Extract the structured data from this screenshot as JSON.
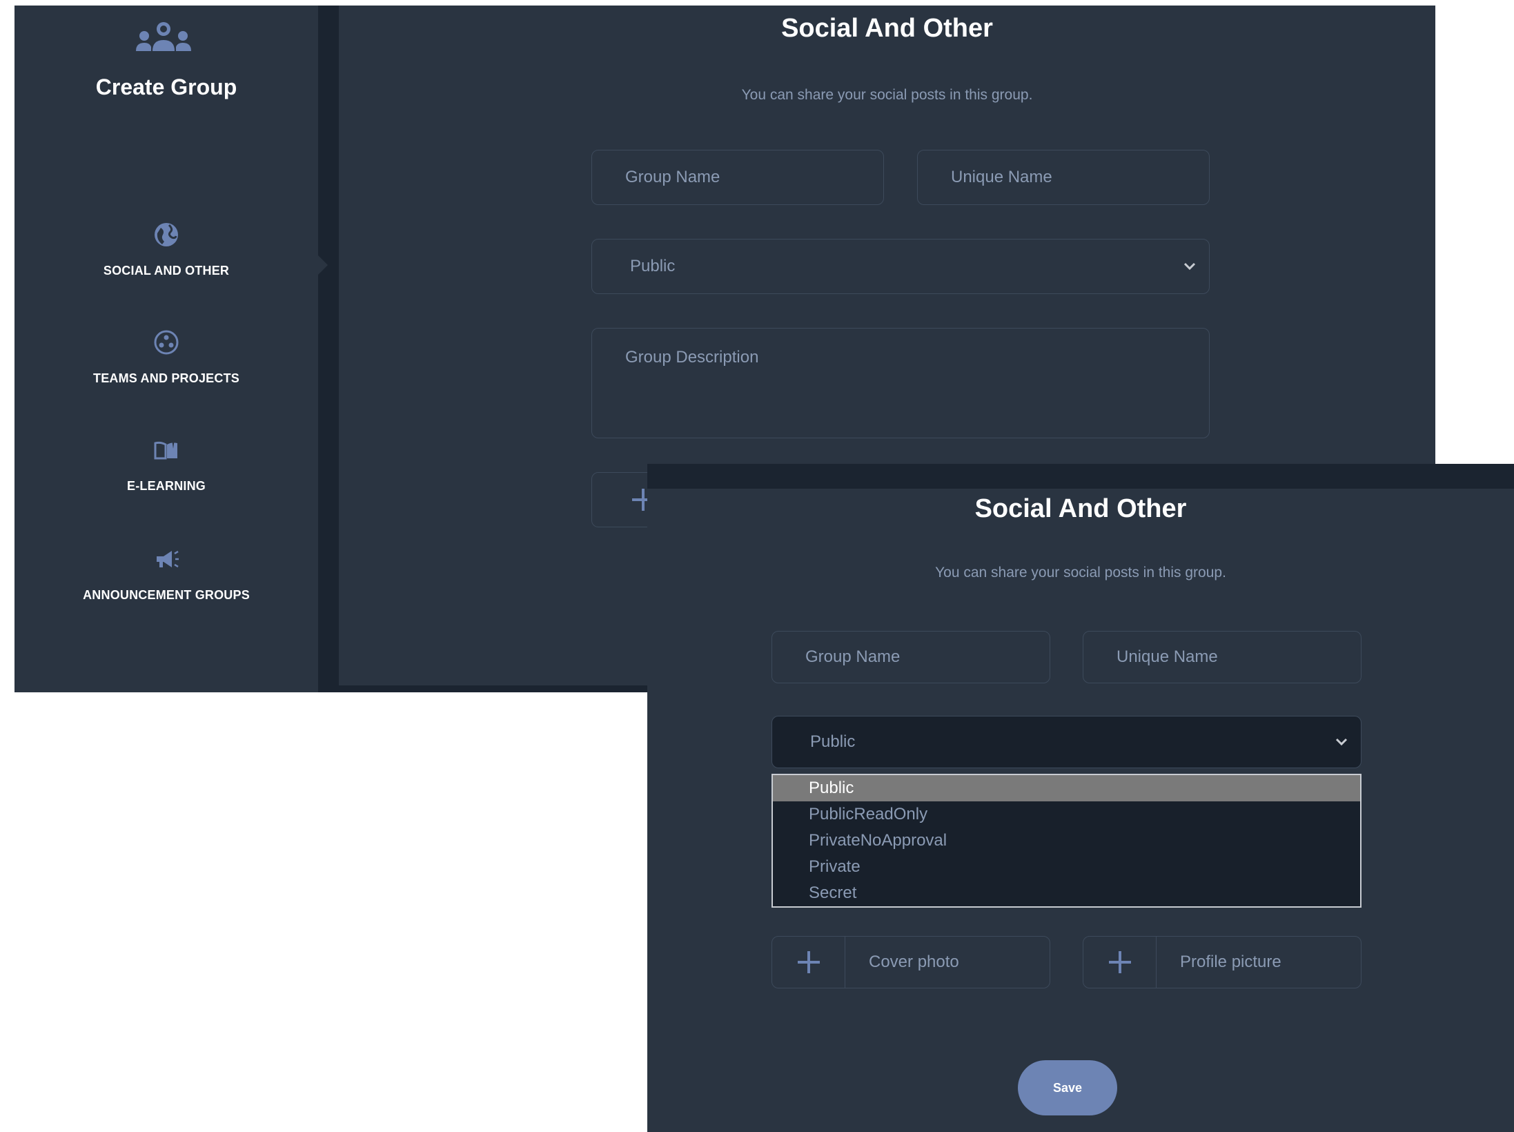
{
  "sidebar": {
    "title": "Create Group",
    "header_icon": "group-icon",
    "items": [
      {
        "label": "SOCIAL AND OTHER",
        "icon": "globe-icon"
      },
      {
        "label": "TEAMS AND PROJECTS",
        "icon": "teams-icon"
      },
      {
        "label": "E-LEARNING",
        "icon": "book-icon"
      },
      {
        "label": "ANNOUNCEMENT GROUPS",
        "icon": "megaphone-icon"
      }
    ]
  },
  "form": {
    "title": "Social And Other",
    "subtitle": "You can share your social posts in this group.",
    "group_name_placeholder": "Group Name",
    "unique_name_placeholder": "Unique Name",
    "privacy_value": "Public",
    "description_placeholder": "Group Description",
    "privacy_options": [
      "Public",
      "PublicReadOnly",
      "PrivateNoApproval",
      "Private",
      "Secret"
    ],
    "cover_photo_label": "Cover photo",
    "profile_picture_label": "Profile picture",
    "save_label": "Save"
  },
  "colors": {
    "background": "#2a3441",
    "accent": "#6d84b4",
    "muted_text": "#8b9bb4"
  }
}
